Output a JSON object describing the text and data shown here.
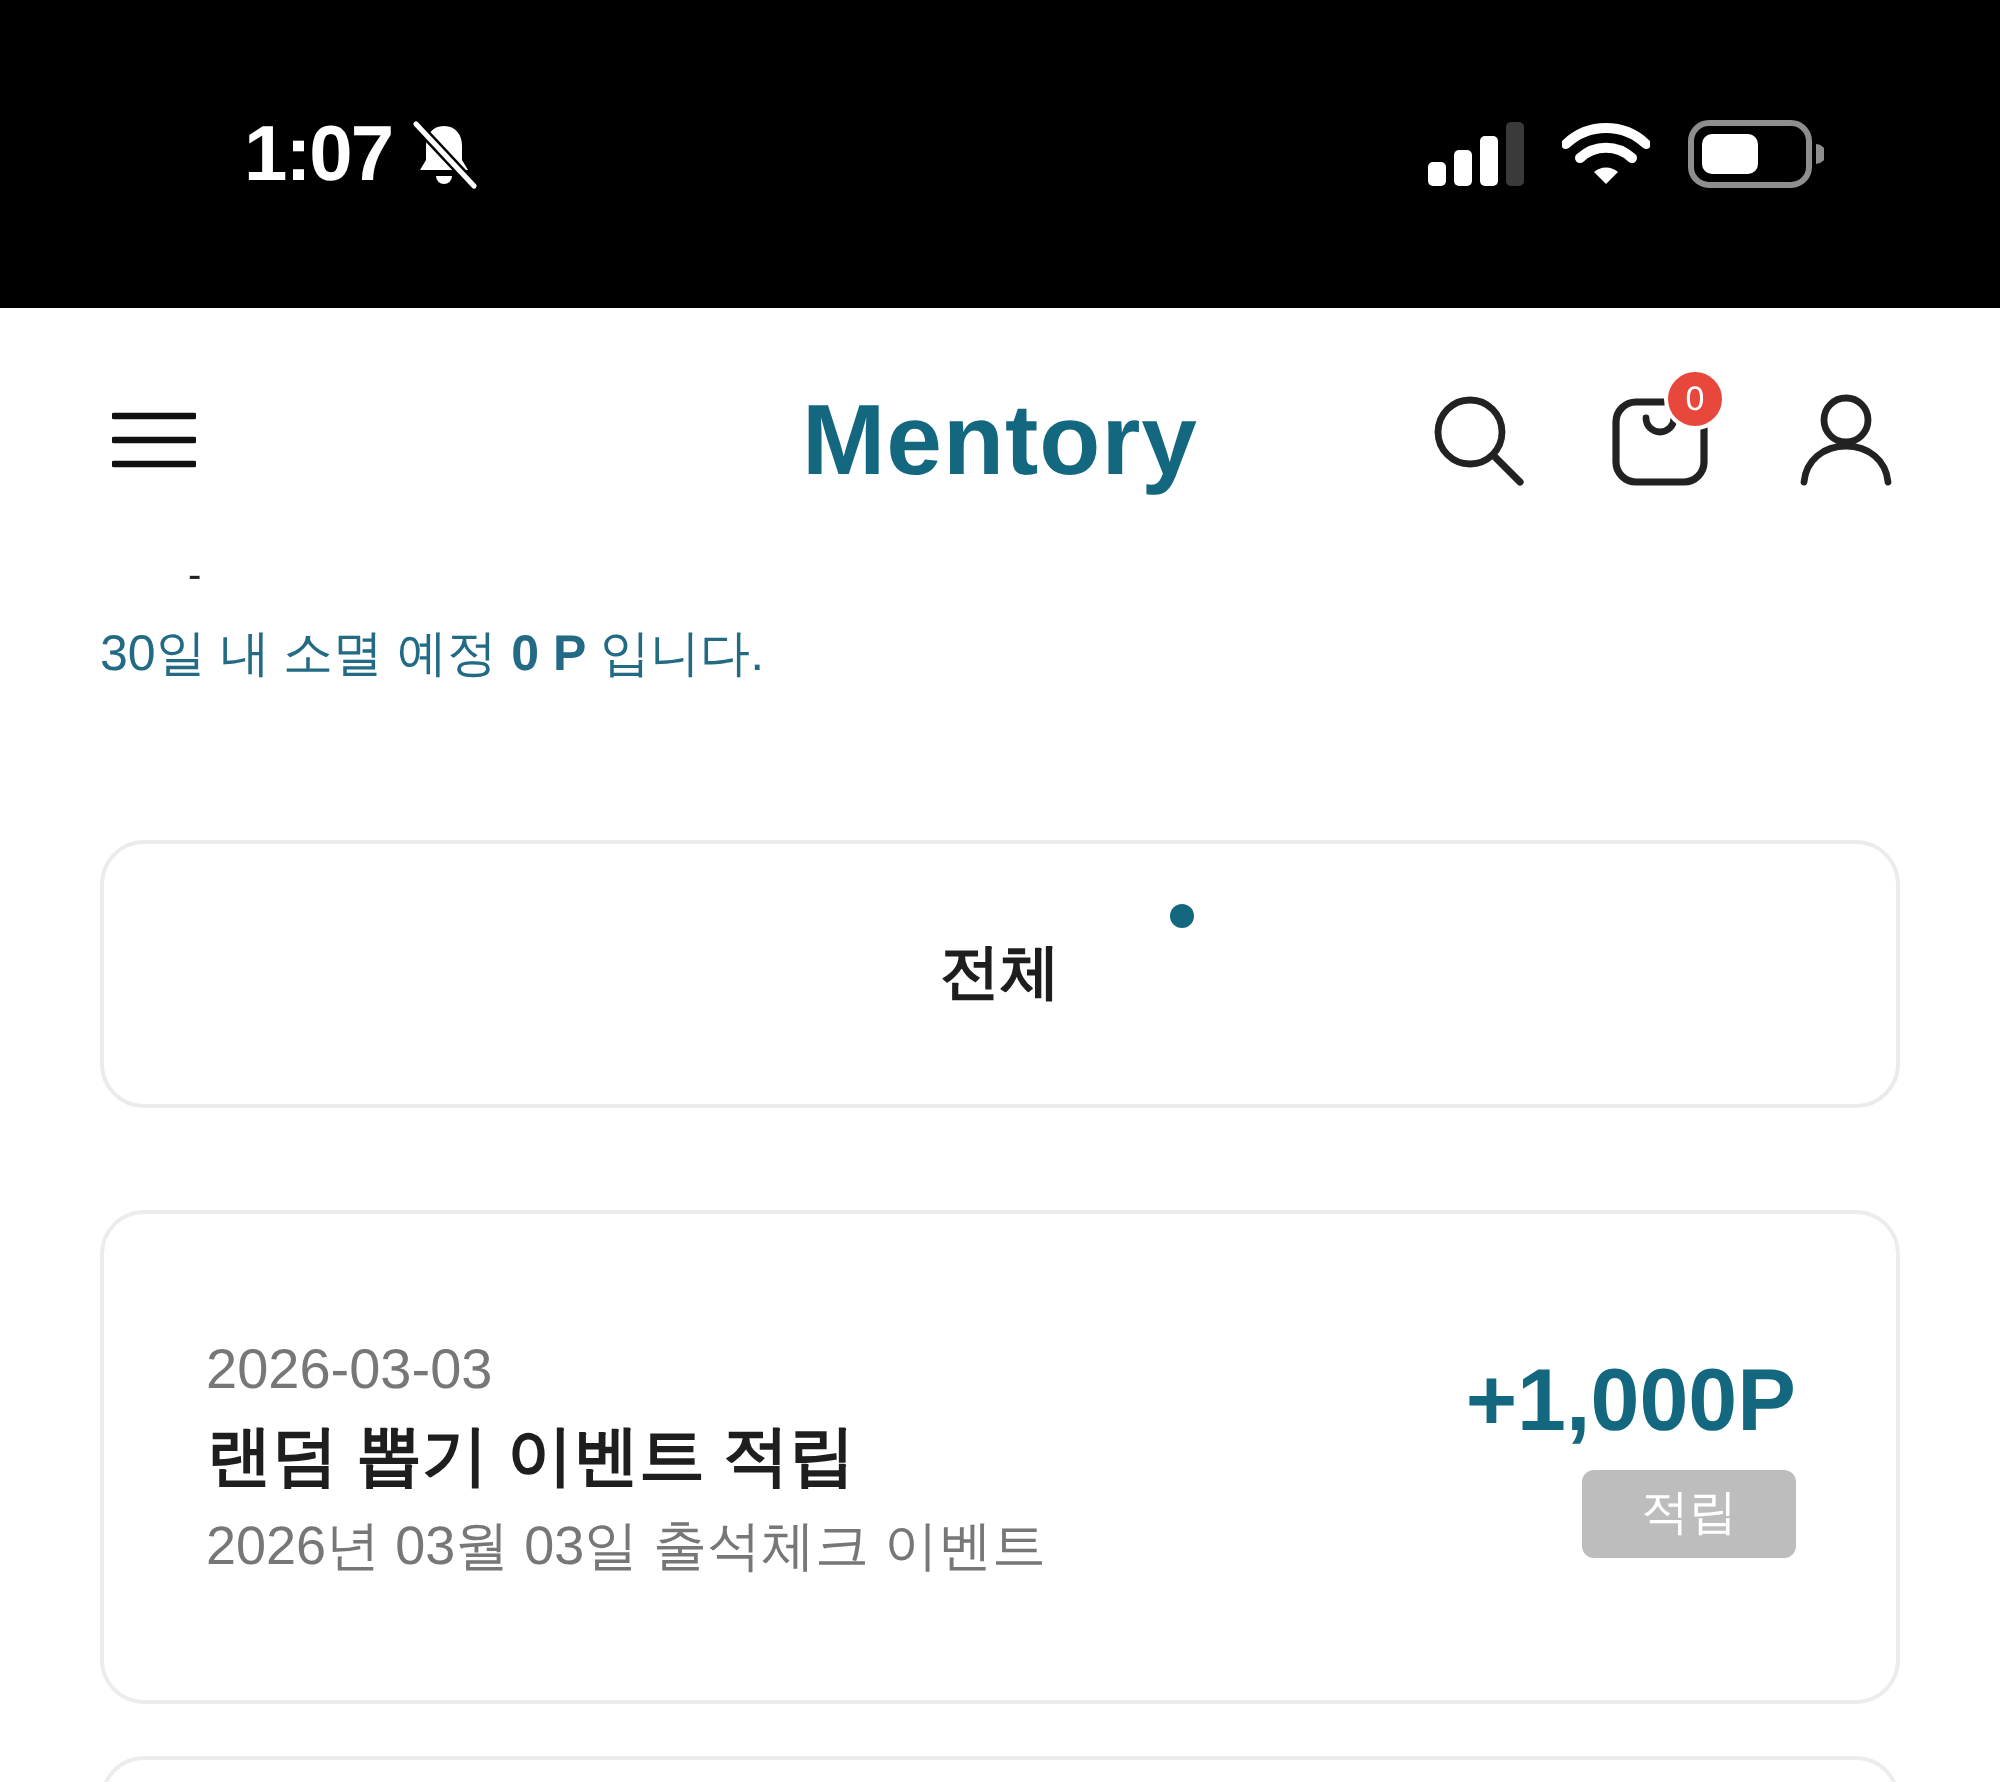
{
  "status_bar": {
    "time": "1:07"
  },
  "header": {
    "logo": "Mentory",
    "cart_count": "0"
  },
  "points_info": {
    "dash": "-",
    "expiring_note": "30일 내 소멸 예정 **0 P** 입니다."
  },
  "filter": {
    "tabs": [
      {
        "label": "전체",
        "selected": true
      }
    ]
  },
  "history": [
    {
      "date": "2026-03-03",
      "title": "랜덤 뽑기 이벤트 적립",
      "description": "2026년 03월 03일 출석체크 이벤트",
      "amount": "+1,000P",
      "badge": "적립"
    }
  ]
}
